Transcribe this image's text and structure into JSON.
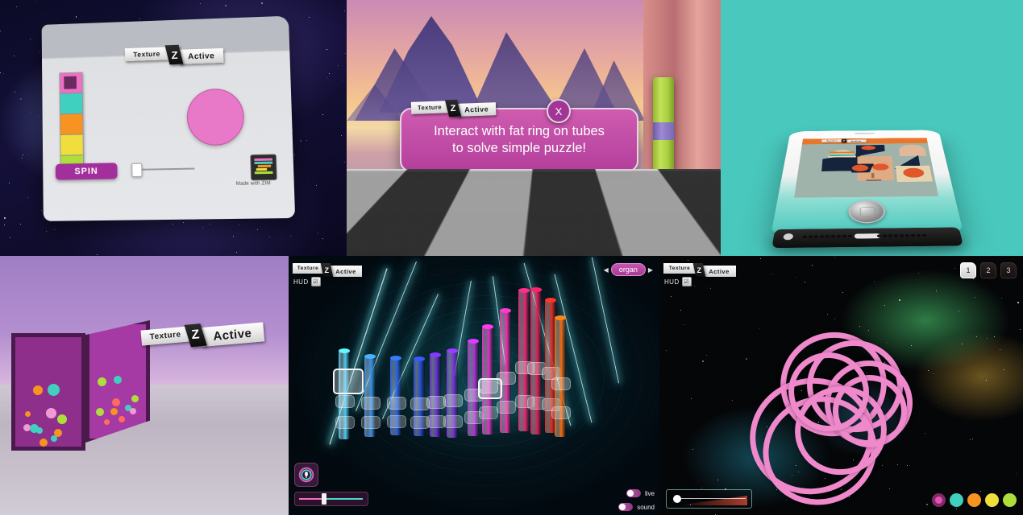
{
  "brand": {
    "badge_left": "Texture",
    "badge_mid": "Z",
    "badge_right": "Active",
    "made_with": "Made with ZIM",
    "zim_mark": "Z"
  },
  "panels": {
    "spin_app": {
      "name": "space-spin-panel",
      "badge": {
        "left": "Texture",
        "mid": "Z",
        "right": "Active"
      },
      "spin_button": "SPIN",
      "made_with": "Made with ZIM",
      "palette": [
        "#ee6fc4",
        "#3fd0c0",
        "#f79421",
        "#efde3c",
        "#aede3c"
      ],
      "selected_swatch_index": 0,
      "selected_swatch_inner": "#6a2a60",
      "circle_color": "#e878c8",
      "slider_value_pct": 3
    },
    "alien_landscape": {
      "name": "alien-landscape-panel",
      "badge": {
        "left": "Texture",
        "mid": "Z",
        "right": "Active"
      },
      "message": "Interact with fat ring on tubes\nto solve simple puzzle!",
      "message_line1": "Interact with fat ring on tubes",
      "message_line2": "to solve simple puzzle!",
      "close_label": "X",
      "bubble_color": "#c250a8"
    },
    "phone_mockup": {
      "name": "phone-mockup-panel",
      "background": "#49c8bd",
      "badge": {
        "left": "Texture",
        "mid": "Z",
        "right": "Active"
      },
      "app_bar_color": "#e8762b"
    },
    "desert_cube": {
      "name": "desert-cube-panel",
      "badge": {
        "left": "Texture",
        "mid": "Z",
        "right": "Active"
      },
      "cube_color": "#9a3398",
      "dot_colors": [
        "#ff6b5c",
        "#3fd0c0",
        "#f79421",
        "#aede3c",
        "#f19ad6"
      ]
    },
    "neon_organ": {
      "name": "neon-organ-panel",
      "badge": {
        "left": "Texture",
        "mid": "Z",
        "right": "Active"
      },
      "hud_label": "HUD",
      "hud_checked": "☑",
      "instrument": "organ",
      "prev_arrow": "◀",
      "next_arrow": "▶",
      "toggles": [
        {
          "label": "live",
          "on": true
        },
        {
          "label": "sound",
          "on": true
        }
      ],
      "slider_value_pct": 30,
      "mic_icon": "mic-icon"
    },
    "nebula_rings": {
      "name": "nebula-rings-panel",
      "badge": {
        "left": "Texture",
        "mid": "Z",
        "right": "Active"
      },
      "hud_label": "HUD",
      "hud_checked": "☑",
      "tabs": [
        {
          "label": "1",
          "selected": true
        },
        {
          "label": "2",
          "selected": false
        },
        {
          "label": "3",
          "selected": false
        }
      ],
      "swatches": [
        "#e64fb8",
        "#3fd0c0",
        "#f79421",
        "#efde3c",
        "#aede3c"
      ],
      "selected_swatch_index": 0,
      "slider_value_pct": 8,
      "ring_color": "#f089cc"
    }
  }
}
